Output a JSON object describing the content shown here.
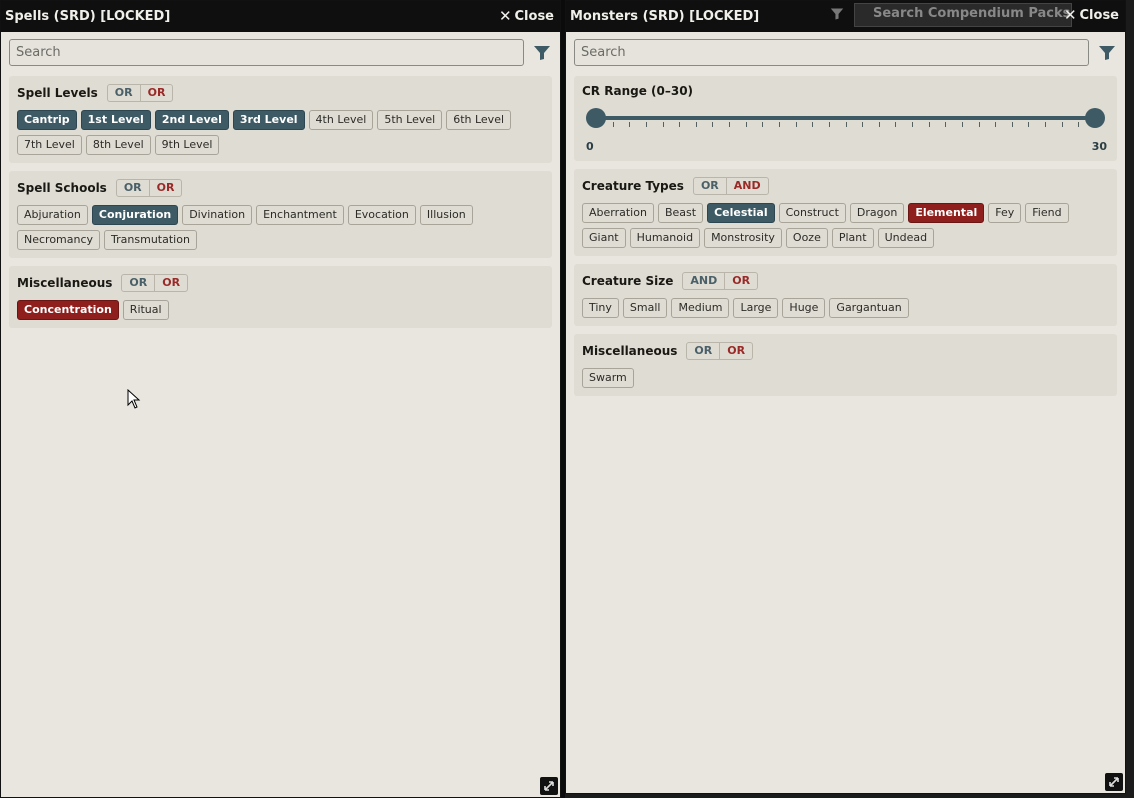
{
  "spells": {
    "title": "Spells (SRD) [LOCKED]",
    "close_label": "Close",
    "search_placeholder": "Search",
    "sections": [
      {
        "title": "Spell Levels",
        "logic": [
          "OR",
          "OR"
        ],
        "tags": [
          {
            "label": "Cantrip",
            "state": "inc"
          },
          {
            "label": "1st Level",
            "state": "inc"
          },
          {
            "label": "2nd Level",
            "state": "inc"
          },
          {
            "label": "3rd Level",
            "state": "inc"
          },
          {
            "label": "4th Level",
            "state": ""
          },
          {
            "label": "5th Level",
            "state": ""
          },
          {
            "label": "6th Level",
            "state": ""
          },
          {
            "label": "7th Level",
            "state": ""
          },
          {
            "label": "8th Level",
            "state": ""
          },
          {
            "label": "9th Level",
            "state": ""
          }
        ]
      },
      {
        "title": "Spell Schools",
        "logic": [
          "OR",
          "OR"
        ],
        "tags": [
          {
            "label": "Abjuration",
            "state": ""
          },
          {
            "label": "Conjuration",
            "state": "inc"
          },
          {
            "label": "Divination",
            "state": ""
          },
          {
            "label": "Enchantment",
            "state": ""
          },
          {
            "label": "Evocation",
            "state": ""
          },
          {
            "label": "Illusion",
            "state": ""
          },
          {
            "label": "Necromancy",
            "state": ""
          },
          {
            "label": "Transmutation",
            "state": ""
          }
        ]
      },
      {
        "title": "Miscellaneous",
        "logic": [
          "OR",
          "OR"
        ],
        "tags": [
          {
            "label": "Concentration",
            "state": "exc"
          },
          {
            "label": "Ritual",
            "state": ""
          }
        ]
      }
    ]
  },
  "monsters": {
    "title": "Monsters (SRD) [LOCKED]",
    "close_label": "Close",
    "compendium_search_placeholder": "Search Compendium Packs",
    "search_placeholder": "Search",
    "cr_range": {
      "title": "CR Range (0–30)",
      "min": 0,
      "max": 30,
      "low": 0,
      "high": 30
    },
    "sections": [
      {
        "title": "Creature Types",
        "logic": [
          "OR",
          "AND"
        ],
        "tags": [
          {
            "label": "Aberration",
            "state": ""
          },
          {
            "label": "Beast",
            "state": ""
          },
          {
            "label": "Celestial",
            "state": "inc"
          },
          {
            "label": "Construct",
            "state": ""
          },
          {
            "label": "Dragon",
            "state": ""
          },
          {
            "label": "Elemental",
            "state": "exc"
          },
          {
            "label": "Fey",
            "state": ""
          },
          {
            "label": "Fiend",
            "state": ""
          },
          {
            "label": "Giant",
            "state": ""
          },
          {
            "label": "Humanoid",
            "state": ""
          },
          {
            "label": "Monstrosity",
            "state": ""
          },
          {
            "label": "Ooze",
            "state": ""
          },
          {
            "label": "Plant",
            "state": ""
          },
          {
            "label": "Undead",
            "state": ""
          }
        ]
      },
      {
        "title": "Creature Size",
        "logic": [
          "AND",
          "OR"
        ],
        "tags": [
          {
            "label": "Tiny",
            "state": ""
          },
          {
            "label": "Small",
            "state": ""
          },
          {
            "label": "Medium",
            "state": ""
          },
          {
            "label": "Large",
            "state": ""
          },
          {
            "label": "Huge",
            "state": ""
          },
          {
            "label": "Gargantuan",
            "state": ""
          }
        ]
      },
      {
        "title": "Miscellaneous",
        "logic": [
          "OR",
          "OR"
        ],
        "tags": [
          {
            "label": "Swarm",
            "state": ""
          }
        ]
      }
    ]
  },
  "colors": {
    "include": "#3e5a64",
    "exclude": "#8f1f1d",
    "panel_bg": "#e9e6df",
    "titlebar": "#0f0f0f"
  }
}
